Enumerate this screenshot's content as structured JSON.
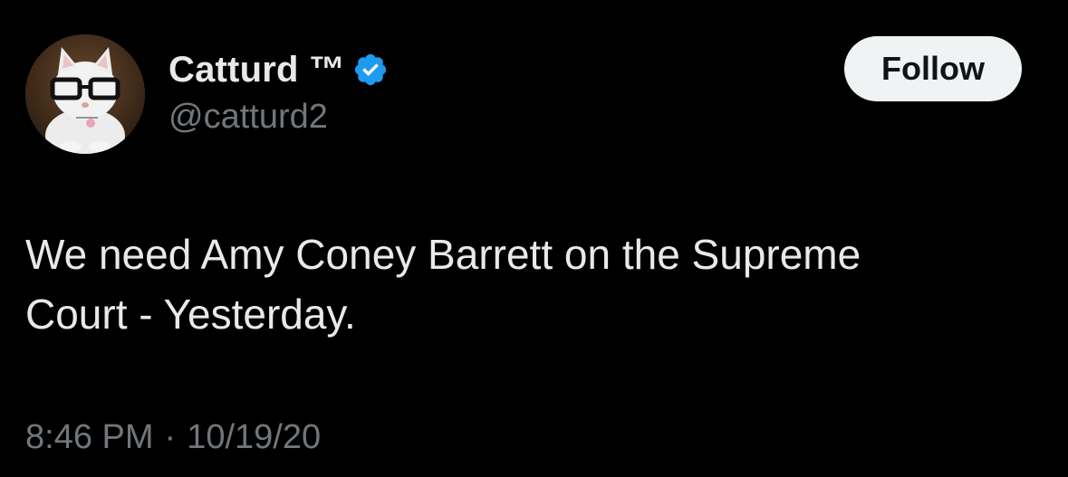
{
  "user": {
    "display_name": "Catturd ™",
    "handle": "@catturd2",
    "verified": true,
    "verified_color": "#1d9bf0",
    "avatar_icon": "cat-with-glasses-avatar"
  },
  "follow_button": {
    "label": "Follow"
  },
  "tweet": {
    "text": "We need Amy Coney Barrett on the Supreme\nCourt - Yesterday.",
    "time": "8:46 PM",
    "separator": "·",
    "date": "10/19/20"
  },
  "colors": {
    "background": "#000000",
    "primary_text": "#e7e9ea",
    "secondary_text": "#71767b",
    "button_bg": "#eff3f4",
    "button_text": "#0f1419"
  }
}
